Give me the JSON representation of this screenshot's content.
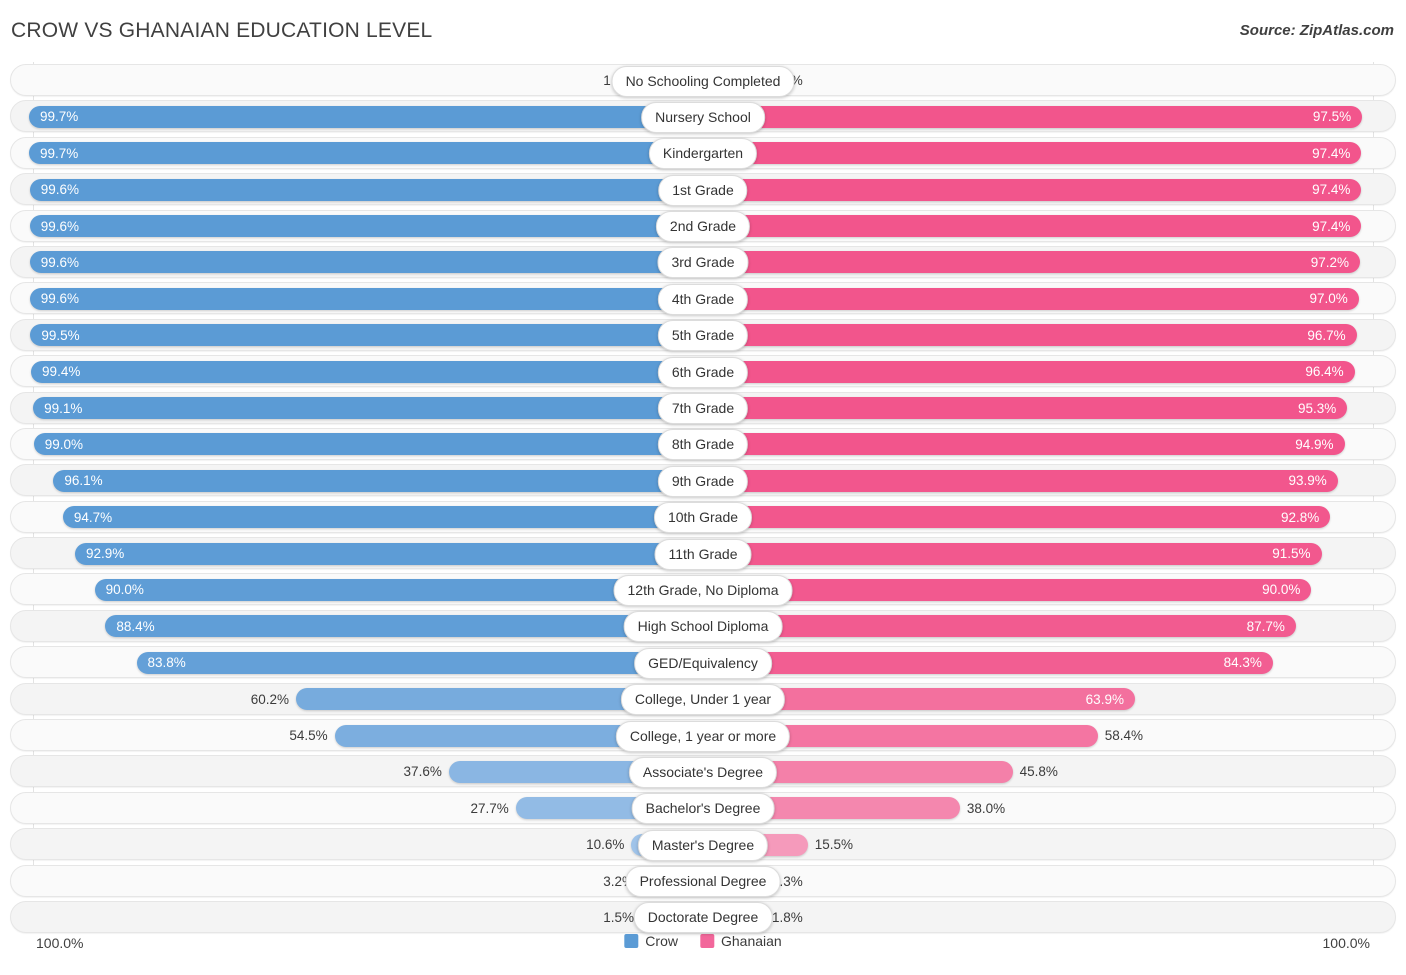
{
  "header": {
    "title": "CROW VS GHANAIAN EDUCATION LEVEL",
    "source": "Source: ZipAtlas.com"
  },
  "axis": {
    "left_max": "100.0%",
    "right_max": "100.0%"
  },
  "legend": {
    "items": [
      {
        "label": "Crow",
        "color": "#5B9BD5"
      },
      {
        "label": "Ghanaian",
        "color": "#F2679B"
      }
    ]
  },
  "colors": {
    "crow_strong": "#5B9BD5",
    "crow_light": "#A8C8EC",
    "ghanaian_strong": "#F2558C",
    "ghanaian_light": "#F6A8C4",
    "track": "#fafafa",
    "track_alt": "#f4f4f4"
  },
  "chart_data": {
    "type": "bar",
    "title": "CROW VS GHANAIAN EDUCATION LEVEL",
    "subtitle": "",
    "orientation": "horizontal-diverging",
    "xlabel": "",
    "ylabel": "",
    "xlim": [
      0,
      100
    ],
    "grid": false,
    "legend_position": "bottom-center",
    "categories": [
      "No Schooling Completed",
      "Nursery School",
      "Kindergarten",
      "1st Grade",
      "2nd Grade",
      "3rd Grade",
      "4th Grade",
      "5th Grade",
      "6th Grade",
      "7th Grade",
      "8th Grade",
      "9th Grade",
      "10th Grade",
      "11th Grade",
      "12th Grade, No Diploma",
      "High School Diploma",
      "GED/Equivalency",
      "College, Under 1 year",
      "College, 1 year or more",
      "Associate's Degree",
      "Bachelor's Degree",
      "Master's Degree",
      "Professional Degree",
      "Doctorate Degree"
    ],
    "series": [
      {
        "name": "Crow",
        "color": "#5B9BD5",
        "values": [
          1.6,
          99.7,
          99.7,
          99.6,
          99.6,
          99.6,
          99.6,
          99.5,
          99.4,
          99.1,
          99.0,
          96.1,
          94.7,
          92.9,
          90.0,
          88.4,
          83.8,
          60.2,
          54.5,
          37.6,
          27.7,
          10.6,
          3.2,
          1.5
        ],
        "labels": [
          "1.6%",
          "99.7%",
          "99.7%",
          "99.6%",
          "99.6%",
          "99.6%",
          "99.6%",
          "99.5%",
          "99.4%",
          "99.1%",
          "99.0%",
          "96.1%",
          "94.7%",
          "92.9%",
          "90.0%",
          "88.4%",
          "83.8%",
          "60.2%",
          "54.5%",
          "37.6%",
          "27.7%",
          "10.6%",
          "3.2%",
          "1.5%"
        ]
      },
      {
        "name": "Ghanaian",
        "color": "#F2679B",
        "values": [
          2.6,
          97.5,
          97.4,
          97.4,
          97.4,
          97.2,
          97.0,
          96.7,
          96.4,
          95.3,
          94.9,
          93.9,
          92.8,
          91.5,
          90.0,
          87.7,
          84.3,
          63.9,
          58.4,
          45.8,
          38.0,
          15.5,
          4.3,
          1.8
        ],
        "labels": [
          "2.6%",
          "97.5%",
          "97.4%",
          "97.4%",
          "97.4%",
          "97.2%",
          "97.0%",
          "96.7%",
          "96.4%",
          "95.3%",
          "94.9%",
          "93.9%",
          "92.8%",
          "91.5%",
          "90.0%",
          "87.7%",
          "84.3%",
          "63.9%",
          "58.4%",
          "45.8%",
          "38.0%",
          "15.5%",
          "4.3%",
          "1.8%"
        ]
      }
    ]
  }
}
